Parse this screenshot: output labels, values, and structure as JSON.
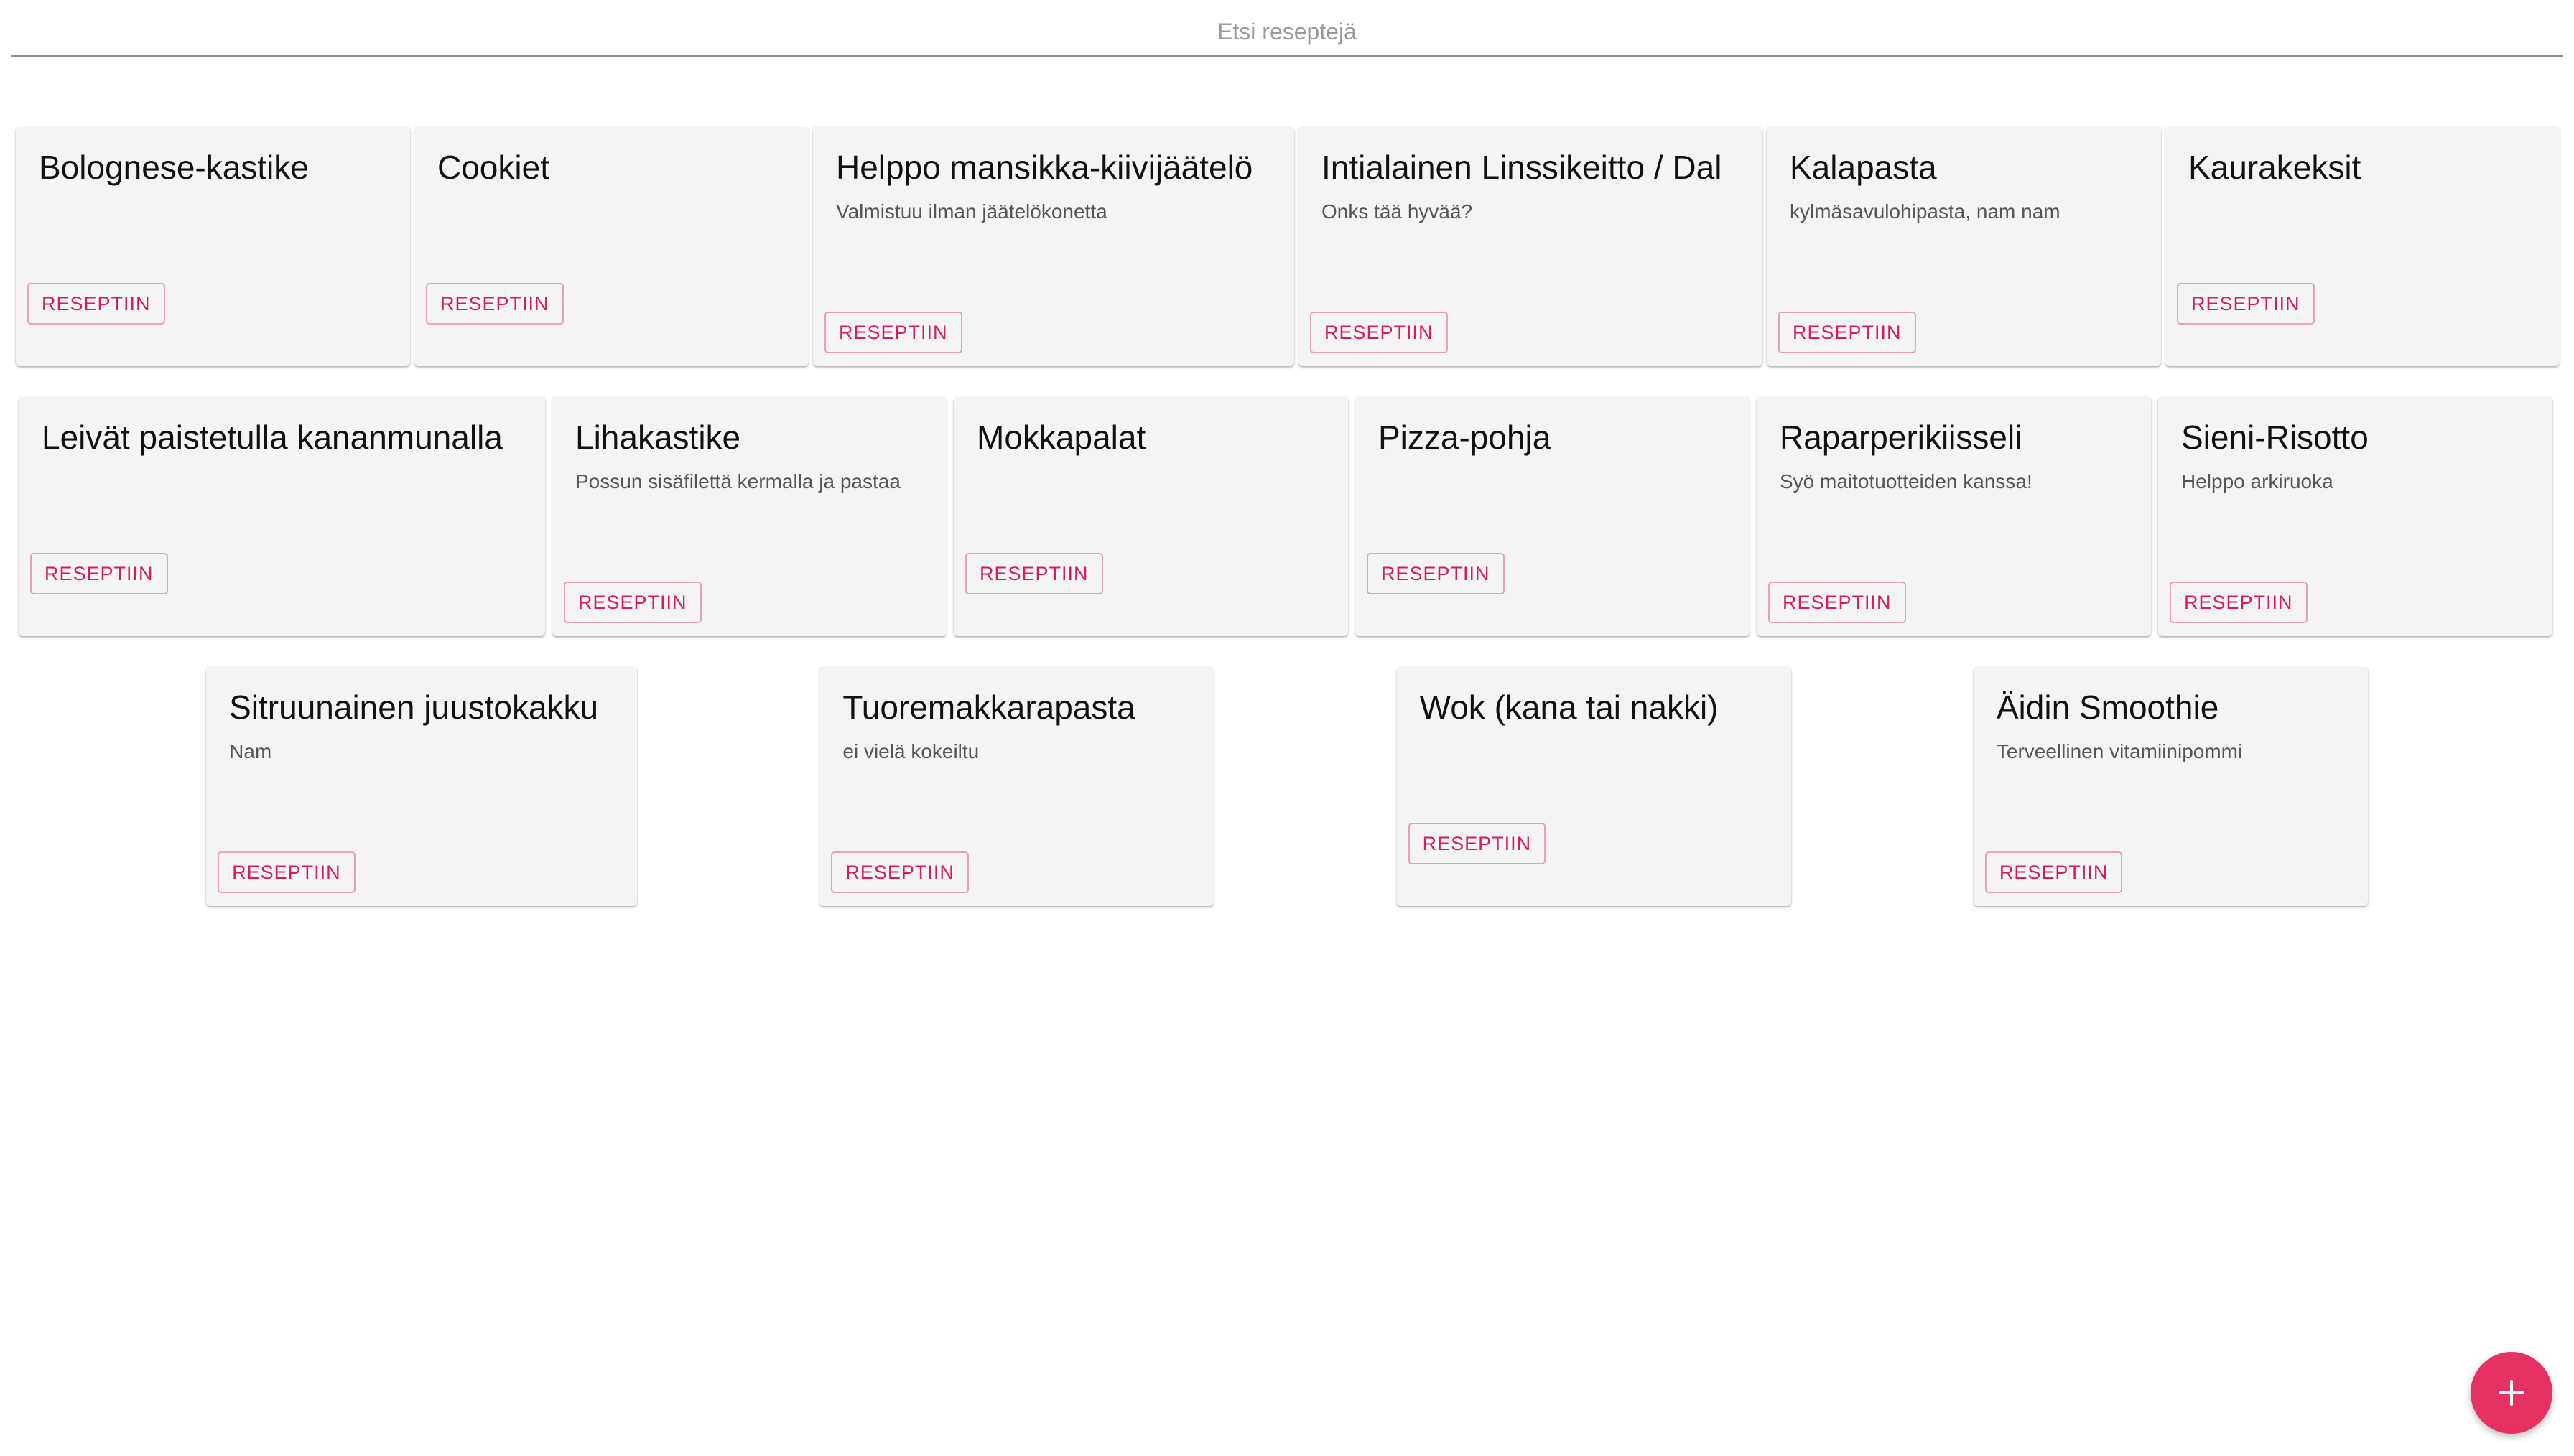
{
  "search": {
    "placeholder": "Etsi reseptejä",
    "value": ""
  },
  "button_label": "RESEPTIIN",
  "recipes": [
    {
      "title": "Bolognese-kastike",
      "description": ""
    },
    {
      "title": "Cookiet",
      "description": ""
    },
    {
      "title": "Helppo mansikka-kiivijäätelö",
      "description": "Valmistuu ilman jäätelökonetta"
    },
    {
      "title": "Intialainen Linssikeitto / Dal",
      "description": "Onks tää hyvää?"
    },
    {
      "title": "Kalapasta",
      "description": "kylmäsavulohipasta, nam nam"
    },
    {
      "title": "Kaurakeksit",
      "description": ""
    },
    {
      "title": "Leivät paistetulla kananmunalla",
      "description": ""
    },
    {
      "title": "Lihakastike",
      "description": "Possun sisäfilettä kermalla ja pastaa"
    },
    {
      "title": "Mokkapalat",
      "description": ""
    },
    {
      "title": "Pizza-pohja",
      "description": ""
    },
    {
      "title": "Raparperikiisseli",
      "description": "Syö maitotuotteiden kanssa!"
    },
    {
      "title": "Sieni-Risotto",
      "description": "Helppo arkiruoka"
    },
    {
      "title": "Sitruunainen juustokakku",
      "description": "Nam"
    },
    {
      "title": "Tuoremakkarapasta",
      "description": "ei vielä kokeiltu"
    },
    {
      "title": "Wok (kana tai nakki)",
      "description": ""
    },
    {
      "title": "Äidin Smoothie",
      "description": "Terveellinen vitamiinipommi"
    }
  ],
  "fab": {
    "icon": "plus-icon"
  },
  "colors": {
    "accent": "#e53263",
    "button_text": "#d81b5a",
    "card_bg": "#f4f4f4"
  }
}
